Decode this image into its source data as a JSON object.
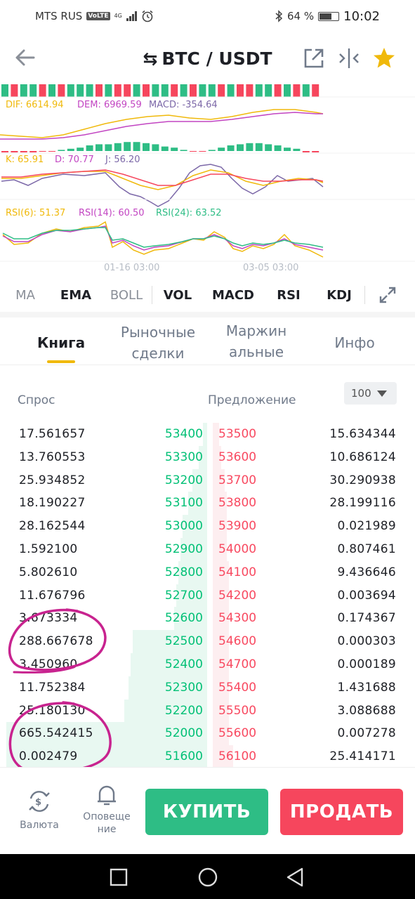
{
  "status_bar": {
    "carrier": "MTS RUS",
    "volte": "VoLTE",
    "network": "4G",
    "battery": "64 %",
    "battery_level": 0.64,
    "time": "10:02"
  },
  "header": {
    "pair": "BTC / USDT",
    "icons": [
      "back-arrow-icon",
      "swap-icon",
      "external-link-icon",
      "compare-icon",
      "star-icon"
    ],
    "star_color": "#f0b90b"
  },
  "chart": {
    "macd_labels": {
      "dif": "DIF: 6614.94",
      "dem": "DEM: 6969.59",
      "macd": "MACD: -354.64"
    },
    "kdj_labels": {
      "k": "K: 65.91",
      "d": "D: 70.77",
      "j": "J: 56.20"
    },
    "rsi_labels": {
      "rsi6": "RSI(6): 51.37",
      "rsi14": "RSI(14): 60.50",
      "rsi24": "RSI(24): 63.52"
    },
    "x_ticks": [
      "01-16 03:00",
      "03-05 03:00"
    ],
    "colors": {
      "up": "#2ebd85",
      "down": "#f6465d",
      "yellow": "#f0b90b",
      "purple": "#c245c2",
      "gray_purple": "#7c68a8",
      "green": "#2ebd85"
    }
  },
  "indicators": {
    "items": [
      {
        "label": "MA",
        "active": false
      },
      {
        "label": "EMA",
        "active": true
      },
      {
        "label": "BOLL",
        "active": false
      },
      {
        "label": "VOL",
        "active": true
      },
      {
        "label": "MACD",
        "active": true
      },
      {
        "label": "RSI",
        "active": true
      },
      {
        "label": "KDJ",
        "active": true
      }
    ]
  },
  "tabs": [
    {
      "label_line1": "Книга",
      "label_line2": "",
      "active": true
    },
    {
      "label_line1": "Рыночные",
      "label_line2": "сделки",
      "active": false
    },
    {
      "label_line1": "Маржин",
      "label_line2": "альные",
      "active": false
    },
    {
      "label_line1": "Инфо",
      "label_line2": "",
      "active": false
    }
  ],
  "order_book": {
    "bid_label": "Спрос",
    "ask_label": "Предложение",
    "depth": "100",
    "rows": [
      {
        "bid_qty": "17.561657",
        "bid_price": "53400",
        "ask_price": "53500",
        "ask_qty": "15.634344"
      },
      {
        "bid_qty": "13.760553",
        "bid_price": "53300",
        "ask_price": "53600",
        "ask_qty": "10.686124"
      },
      {
        "bid_qty": "25.934852",
        "bid_price": "53200",
        "ask_price": "53700",
        "ask_qty": "30.290938"
      },
      {
        "bid_qty": "18.190227",
        "bid_price": "53100",
        "ask_price": "53800",
        "ask_qty": "28.199116"
      },
      {
        "bid_qty": "28.162544",
        "bid_price": "53000",
        "ask_price": "53900",
        "ask_qty": "0.021989"
      },
      {
        "bid_qty": "1.592100",
        "bid_price": "52900",
        "ask_price": "54000",
        "ask_qty": "0.807461"
      },
      {
        "bid_qty": "5.802610",
        "bid_price": "52800",
        "ask_price": "54100",
        "ask_qty": "9.436646"
      },
      {
        "bid_qty": "11.676796",
        "bid_price": "52700",
        "ask_price": "54200",
        "ask_qty": "0.003694"
      },
      {
        "bid_qty": "3.673334",
        "bid_price": "52600",
        "ask_price": "54300",
        "ask_qty": "0.174367"
      },
      {
        "bid_qty": "288.667678",
        "bid_price": "52500",
        "ask_price": "54600",
        "ask_qty": "0.000303"
      },
      {
        "bid_qty": "3.450960",
        "bid_price": "52400",
        "ask_price": "54700",
        "ask_qty": "0.000189"
      },
      {
        "bid_qty": "11.752384",
        "bid_price": "52300",
        "ask_price": "55400",
        "ask_qty": "1.431688"
      },
      {
        "bid_qty": "25.180130",
        "bid_price": "52200",
        "ask_price": "55500",
        "ask_qty": "3.088688"
      },
      {
        "bid_qty": "665.542415",
        "bid_price": "52000",
        "ask_price": "55600",
        "ask_qty": "0.007278"
      },
      {
        "bid_qty": "0.002479",
        "bid_price": "51600",
        "ask_price": "56100",
        "ask_qty": "25.414171"
      }
    ],
    "bid_depth_fraction": [
      0.02,
      0.04,
      0.07,
      0.09,
      0.12,
      0.13,
      0.14,
      0.15,
      0.16,
      0.36,
      0.37,
      0.38,
      0.4,
      0.97,
      0.97
    ],
    "ask_depth_fraction": [
      0.03,
      0.04,
      0.06,
      0.07,
      0.07,
      0.07,
      0.08,
      0.08,
      0.08,
      0.08,
      0.08,
      0.08,
      0.08,
      0.08,
      0.1
    ]
  },
  "bottom_bar": {
    "currency_label": "Валюта",
    "alerts_label_1": "Оповеще",
    "alerts_label_2": "ние",
    "buy_label": "КУПИТЬ",
    "sell_label": "ПРОДАТЬ",
    "buy_color": "#2ebd85",
    "sell_color": "#f6465d"
  },
  "annotation_color": "#c8238f"
}
